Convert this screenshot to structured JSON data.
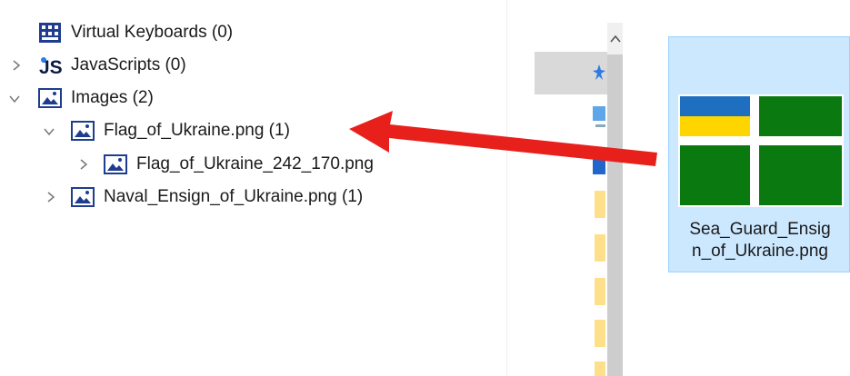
{
  "tree": {
    "items": [
      {
        "label": "Virtual Keyboards (0)",
        "icon": "keyboard-icon"
      },
      {
        "label": "JavaScripts (0)",
        "icon": "javascript-icon"
      },
      {
        "label": "Images (2)",
        "icon": "image-icon"
      },
      {
        "label": "Flag_of_Ukraine.png (1)",
        "icon": "image-icon"
      },
      {
        "label": "Flag_of_Ukraine_242_170.png",
        "icon": "image-icon"
      },
      {
        "label": "Naval_Ensign_of_Ukraine.png (1)",
        "icon": "image-icon"
      }
    ]
  },
  "explorer": {
    "file": {
      "name_line1": "Sea_Guard_Ensig",
      "name_line2": "n_of_Ukraine.png",
      "thumbnail_icon": "sea-guard-ensign-thumbnail"
    },
    "colors": {
      "selection": "#cce8ff",
      "flag_blue": "#1f6fc1",
      "flag_yellow": "#ffd500",
      "flag_green": "#0a7a10",
      "arrow": "#e8201c"
    }
  }
}
